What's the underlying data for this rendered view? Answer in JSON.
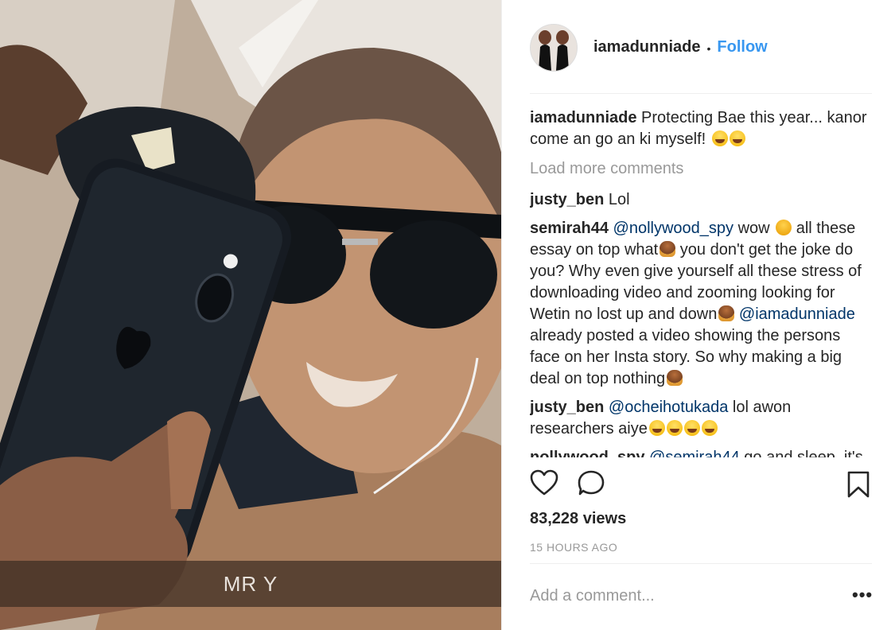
{
  "media": {
    "overlay_text": "MR Y"
  },
  "post": {
    "username": "iamadunniade",
    "separator": "•",
    "follow_label": "Follow",
    "caption_user": "iamadunniade",
    "caption_text": "Protecting Bae this year... kanor come an go an ki myself!",
    "load_more": "Load more comments",
    "comments": [
      {
        "user": "justy_ben",
        "text": "Lol"
      },
      {
        "user": "semirah44",
        "mention1": "@nollywood_spy",
        "text1": "wow",
        "text2": "all these essay on top what",
        "text3": "you don't get the joke do you? Why even give yourself all these stress of downloading video and zooming looking for Wetin no lost up and down",
        "mention2": "@iamadunniade",
        "text4": "already posted a video showing the persons face on her Insta story. So why making a big deal on top nothing"
      },
      {
        "user": "justy_ben",
        "mention1": "@ocheihotukada",
        "text1": "lol awon researchers aiye"
      },
      {
        "user": "nollywood_spy",
        "mention1": "@semirah44",
        "text1": "go and sleep, it's"
      }
    ],
    "icons": {
      "like": "heart-icon",
      "comment": "comment-bubble-icon",
      "save": "bookmark-icon",
      "more": "more-options-icon"
    },
    "views": "83,228 views",
    "time_ago": "15 HOURS AGO",
    "add_comment_placeholder": "Add a comment...",
    "more_label": "•••"
  },
  "colors": {
    "link": "#3897f0",
    "mention": "#003569",
    "muted": "#999999",
    "text": "#262626"
  }
}
